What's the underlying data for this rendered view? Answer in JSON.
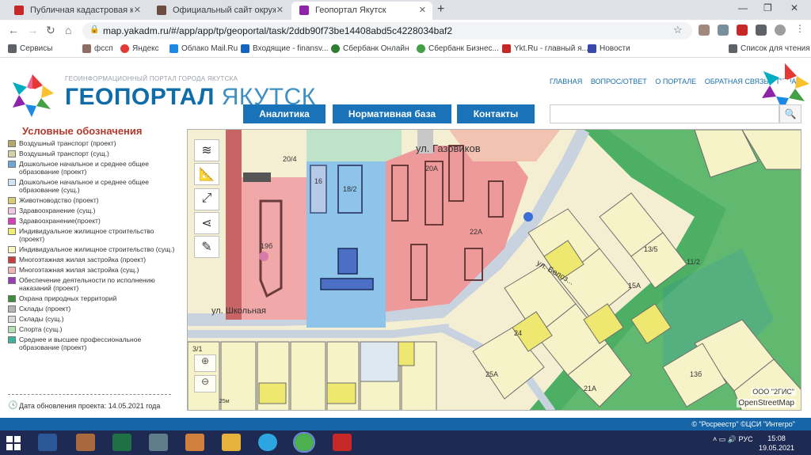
{
  "browser": {
    "tabs": [
      {
        "title": "Публичная кадастровая карта",
        "active": false,
        "icon_color": "#c62828"
      },
      {
        "title": "Официальный сайт окружной а",
        "active": false,
        "icon_color": "#6d4c41"
      },
      {
        "title": "Геопортал Якутск",
        "active": true,
        "icon_color": "#8e24aa"
      }
    ],
    "url": "map.yakadm.ru/#/app/app/tp/geoportal/task/2ddb90f73be14408abd5c4228034baf2",
    "bookmarks": [
      {
        "label": "Сервисы",
        "icon_color": "#5f6368"
      },
      {
        "label": "фссп",
        "icon_color": "#8d6e63"
      },
      {
        "label": "Яндекс",
        "icon_color": "#e53935"
      },
      {
        "label": "Облако Mail.Ru",
        "icon_color": "#1e88e5"
      },
      {
        "label": "Входящие - finansv...",
        "icon_color": "#1565c0"
      },
      {
        "label": "Сбербанк Онлайн",
        "icon_color": "#2e7d32"
      },
      {
        "label": "Сбербанк Бизнес...",
        "icon_color": "#43a047"
      },
      {
        "label": "Ykt.Ru - главный я...",
        "icon_color": "#c62828"
      },
      {
        "label": "Новости",
        "icon_color": "#3949ab"
      }
    ],
    "reading_list": "Список для чтения"
  },
  "header": {
    "subtitle": "ГЕОИНФОРМАЦИОННЫЙ ПОРТАЛ ГОРОДА ЯКУТСКА",
    "brand_bold": "ГЕОПОРТАЛ",
    "brand_light": "ЯКУТСК",
    "menu": [
      "ГЛАВНАЯ",
      "ВОПРОС/ОТВЕТ",
      "О ПОРТАЛЕ",
      "ОБРАТНАЯ СВЯЗЬ",
      "ПЕЧАТЬ"
    ],
    "buttons": [
      "Аналитика",
      "Нормативная база",
      "Контакты"
    ],
    "search_placeholder": ""
  },
  "legend": {
    "title": "Условные обозначения",
    "items": [
      {
        "label": "Воздушный транспорт (проект)",
        "color": "#b5a96a"
      },
      {
        "label": "Воздушный транспорт (сущ.)",
        "color": "#d6d2a8"
      },
      {
        "label": "Дошкольное начальное и среднее общее образование (проект)",
        "color": "#6fa8d6"
      },
      {
        "label": "Дошкольное начальное и среднее общее образование (сущ.)",
        "color": "#cfe3f3"
      },
      {
        "label": "Животноводство (проект)",
        "color": "#d8cc70"
      },
      {
        "label": "Здравоохранение (сущ.)",
        "color": "#f0c8e6"
      },
      {
        "label": "Здравоохранение(проект)",
        "color": "#d63fb8"
      },
      {
        "label": "Индивидуальное жилищное строительство (проект)",
        "color": "#f0ee70"
      },
      {
        "label": "Индивидуальное жилищное строительство (сущ.)",
        "color": "#f7f5c0"
      },
      {
        "label": "Многоэтажная жилая застройка (проект)",
        "color": "#c83c3c"
      },
      {
        "label": "Многоэтажная жилая застройка (сущ.)",
        "color": "#f0b4b4"
      },
      {
        "label": "Обеспечение деятельности по исполнению наказаний (проект)",
        "color": "#9c3cb4"
      },
      {
        "label": "Охрана природных территорий",
        "color": "#3c8c3c"
      },
      {
        "label": "Склады (проект)",
        "color": "#b4b4b4"
      },
      {
        "label": "Склады (сущ.)",
        "color": "#d8d8d8"
      },
      {
        "label": "Спорта (сущ.)",
        "color": "#b4e0b4"
      },
      {
        "label": "Среднее и высшее профессиональное образование (проект)",
        "color": "#3cb4a0"
      }
    ],
    "update_date": "Дата обновления проекта: 14.05.2021 года"
  },
  "map": {
    "street_labels": [
      "ул. Газовиков",
      "ул. Школьная",
      "ул. Белоз..."
    ],
    "lot_labels": [
      "18/2",
      "20/4",
      "20А",
      "16",
      "19б",
      "22А",
      "13/5",
      "15А",
      "21А",
      "24",
      "11/2",
      "3/1",
      "25А",
      "13б"
    ],
    "attribution_2gis": "ООО \"2ГИС\"",
    "attribution_osm": "OpenStreetMap",
    "scale_label": "25м",
    "tools": [
      "layers-icon",
      "ruler-icon",
      "fullscreen-icon",
      "share-icon",
      "edit-icon"
    ]
  },
  "footer": {
    "copyright": "© \"Росреестр\" ©ЦСИ \"Интегро\""
  },
  "taskbar": {
    "apps": [
      {
        "name": "word",
        "color": "#2b5797"
      },
      {
        "name": "folder-photos",
        "color": "#a86a3c"
      },
      {
        "name": "excel",
        "color": "#1e7145"
      },
      {
        "name": "calculator",
        "color": "#607d8b"
      },
      {
        "name": "paint",
        "color": "#d0803c"
      },
      {
        "name": "explorer",
        "color": "#e6b23c"
      },
      {
        "name": "telegram",
        "color": "#2ca5e0"
      },
      {
        "name": "chrome",
        "color": "#4caf50"
      },
      {
        "name": "pdf",
        "color": "#c62828"
      }
    ],
    "lang": "РУС",
    "time": "15:08",
    "date": "19.05.2021"
  }
}
